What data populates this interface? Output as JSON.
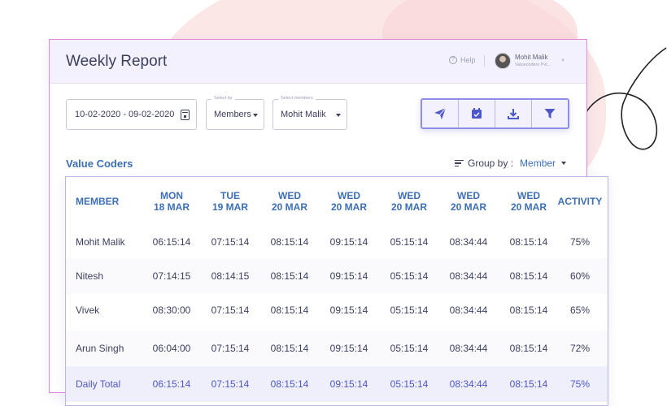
{
  "header": {
    "title": "Weekly Report",
    "help_label": "Help",
    "user_name": "Mohit Malik",
    "user_org": "Valuecoders Pvt..."
  },
  "filters": {
    "date_range": "10-02-2020 - 09-02-2020",
    "select_by_label": "Select by",
    "select_by_value": "Members",
    "select_members_label": "Select members",
    "select_members_value": "Mohit Malik"
  },
  "toolbar": {
    "icons": [
      "send-icon",
      "calendar-icon",
      "download-icon",
      "filter-icon"
    ]
  },
  "section": {
    "title": "Value Coders",
    "group_by_label": "Group by :",
    "group_by_value": "Member"
  },
  "table": {
    "columns": [
      {
        "line1": "MEMBER",
        "line2": ""
      },
      {
        "line1": "MON",
        "line2": "18 MAR"
      },
      {
        "line1": "TUE",
        "line2": "19 MAR"
      },
      {
        "line1": "WED",
        "line2": "20 MAR"
      },
      {
        "line1": "WED",
        "line2": "20 MAR"
      },
      {
        "line1": "WED",
        "line2": "20 MAR"
      },
      {
        "line1": "WED",
        "line2": "20 MAR"
      },
      {
        "line1": "WED",
        "line2": "20 MAR"
      },
      {
        "line1": "ACTIVITY",
        "line2": ""
      }
    ],
    "rows": [
      [
        "Mohit Malik",
        "06:15:14",
        "07:15:14",
        "08:15:14",
        "09:15:14",
        "05:15:14",
        "08:34:44",
        "08:15:14",
        "75%"
      ],
      [
        "Nitesh",
        "07:14:15",
        "08:14:15",
        "08:15:14",
        "09:15:14",
        "05:15:14",
        "08:34:44",
        "08:15:14",
        "60%"
      ],
      [
        "Vivek",
        "08:30:00",
        "07:15:14",
        "08:15:14",
        "09:15:14",
        "05:15:14",
        "08:34:44",
        "08:15:14",
        "65%"
      ],
      [
        "Arun Singh",
        "06:04:00",
        "07:15:14",
        "08:15:14",
        "09:15:14",
        "05:15:14",
        "08:34:44",
        "08:15:14",
        "72%"
      ]
    ],
    "total": [
      "Daily Total",
      "06:15:14",
      "07:15:14",
      "08:15:14",
      "09:15:14",
      "05:15:14",
      "08:34:44",
      "08:15:14",
      "75%"
    ]
  },
  "colors": {
    "accent": "#3c6fb5",
    "total_text": "#4e57c8",
    "panel_border": "#e08adb",
    "toolbar_border": "#8e8ee6"
  }
}
